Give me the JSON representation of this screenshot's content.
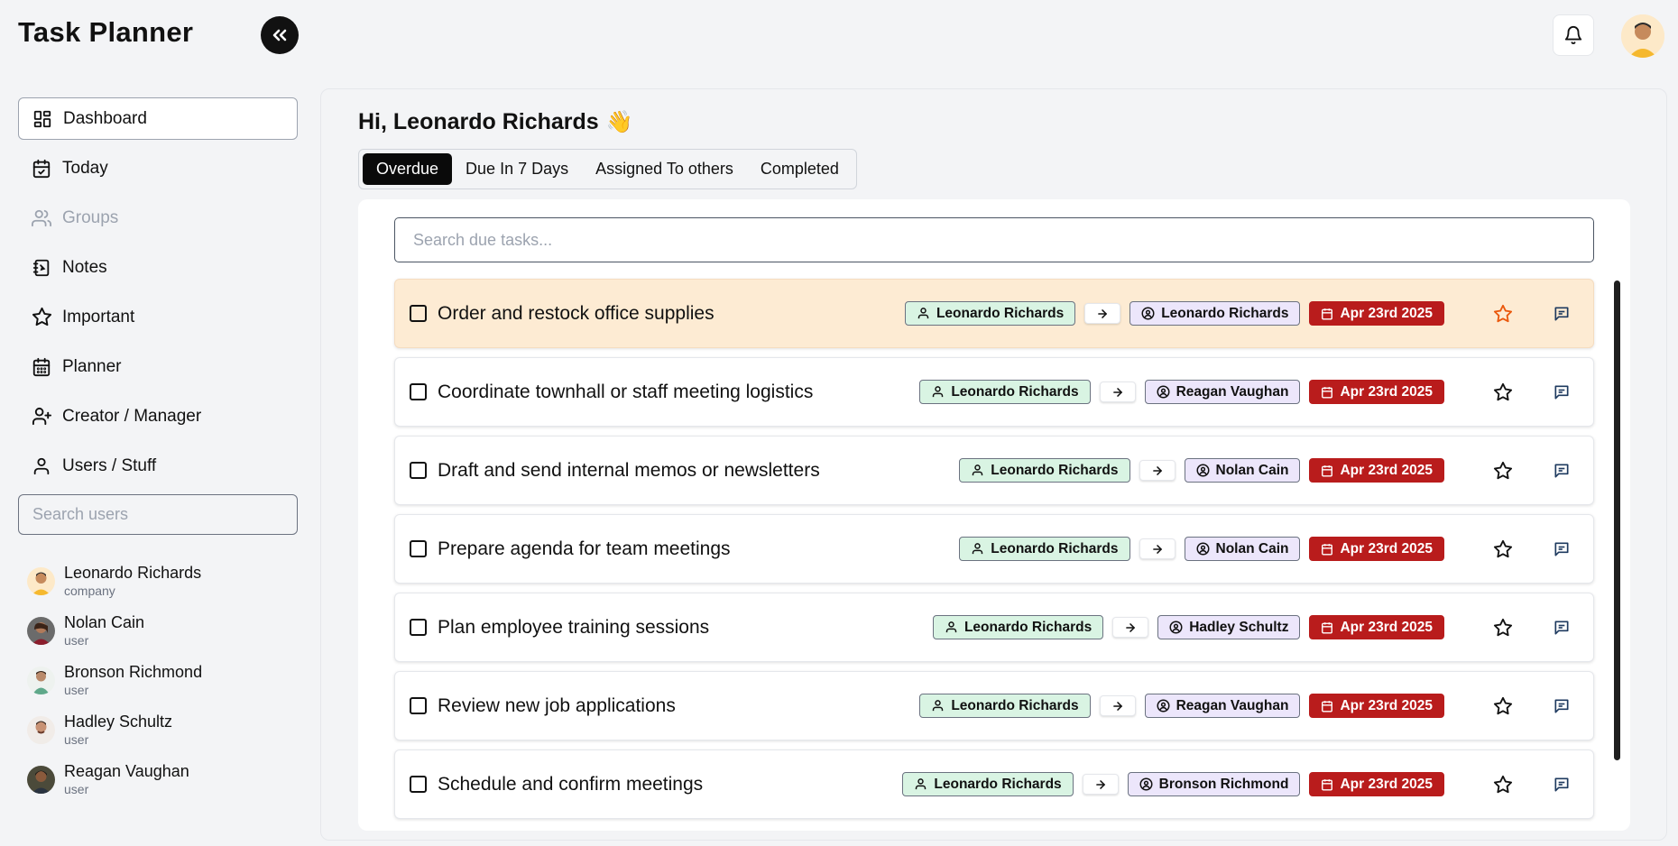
{
  "app": {
    "title": "Task Planner"
  },
  "sidebar": {
    "items": [
      {
        "label": "Dashboard",
        "icon": "dashboard-icon",
        "active": true
      },
      {
        "label": "Today",
        "icon": "calendar-check-icon"
      },
      {
        "label": "Groups",
        "icon": "users-icon",
        "disabled": true
      },
      {
        "label": "Notes",
        "icon": "notebook-icon"
      },
      {
        "label": "Important",
        "icon": "star-icon"
      },
      {
        "label": "Planner",
        "icon": "calendar-icon"
      },
      {
        "label": "Creator / Manager",
        "icon": "user-plus-icon"
      },
      {
        "label": "Users / Stuff",
        "icon": "user-icon"
      }
    ],
    "user_search_placeholder": "Search users",
    "users": [
      {
        "name": "Leonardo Richards",
        "role": "company"
      },
      {
        "name": "Nolan Cain",
        "role": "user"
      },
      {
        "name": "Bronson Richmond",
        "role": "user"
      },
      {
        "name": "Hadley Schultz",
        "role": "user"
      },
      {
        "name": "Reagan Vaughan",
        "role": "user"
      }
    ]
  },
  "main": {
    "greeting": "Hi, Leonardo Richards",
    "greeting_emoji": "👋",
    "tabs": [
      {
        "label": "Overdue",
        "active": true
      },
      {
        "label": "Due In 7 Days"
      },
      {
        "label": "Assigned To others"
      },
      {
        "label": "Completed"
      }
    ],
    "search_placeholder": "Search due tasks...",
    "tasks": [
      {
        "title": "Order and restock office supplies",
        "creator": "Leonardo Richards",
        "assignee": "Leonardo Richards",
        "due": "Apr 23rd 2025",
        "highlight": true,
        "starred": true
      },
      {
        "title": "Coordinate townhall or staff meeting logistics",
        "creator": "Leonardo Richards",
        "assignee": "Reagan Vaughan",
        "due": "Apr 23rd 2025"
      },
      {
        "title": "Draft and send internal memos or newsletters",
        "creator": "Leonardo Richards",
        "assignee": "Nolan Cain",
        "due": "Apr 23rd 2025"
      },
      {
        "title": "Prepare agenda for team meetings",
        "creator": "Leonardo Richards",
        "assignee": "Nolan Cain",
        "due": "Apr 23rd 2025"
      },
      {
        "title": "Plan employee training sessions",
        "creator": "Leonardo Richards",
        "assignee": "Hadley Schultz",
        "due": "Apr 23rd 2025"
      },
      {
        "title": "Review new job applications",
        "creator": "Leonardo Richards",
        "assignee": "Reagan Vaughan",
        "due": "Apr 23rd 2025"
      },
      {
        "title": "Schedule and confirm meetings",
        "creator": "Leonardo Richards",
        "assignee": "Bronson Richmond",
        "due": "Apr 23rd 2025"
      }
    ]
  },
  "colors": {
    "accent": "#0a0a0a",
    "due_chip": "#b91c1c",
    "creator_chip": "#d9f4e3",
    "assignee_chip": "#ece6fb",
    "highlight_row": "#fdebd3",
    "starred": "#ea580c"
  }
}
